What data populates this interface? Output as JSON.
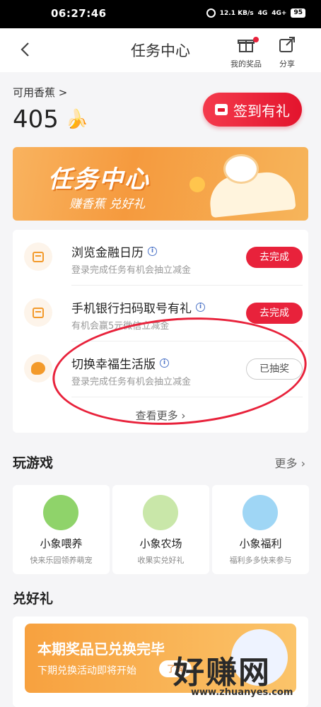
{
  "status": {
    "time": "06:27:46",
    "speed": "12.1 KB/s",
    "net1": "4G",
    "net2": "4G+",
    "battery": "95"
  },
  "header": {
    "title": "任务中心",
    "prizes_label": "我的奖品",
    "share_label": "分享"
  },
  "balance": {
    "label": "可用香蕉",
    "chevron": ">",
    "count": "405",
    "banana_emoji": "🍌"
  },
  "checkin_label": "签到有礼",
  "banner": {
    "headline": "任务中心",
    "subline": "赚香蕉 兑好礼"
  },
  "tasks": [
    {
      "title": "浏览金融日历",
      "desc": "登录完成任务有机会抽立减金",
      "action": "去完成",
      "icon": "calendar-icon"
    },
    {
      "title": "手机银行扫码取号有礼",
      "desc": "有机会赢5元微信立减金",
      "action": "去完成",
      "icon": "calendar-icon"
    },
    {
      "title": "切换幸福生活版",
      "desc": "登录完成任务有机会抽立减金",
      "action": "已抽奖",
      "icon": "palette-icon"
    }
  ],
  "see_more": "查看更多",
  "games_section": {
    "title": "玩游戏",
    "more": "更多"
  },
  "games": [
    {
      "name": "小象喂养",
      "desc": "快来乐园领养萌宠",
      "color": "#8fd36a"
    },
    {
      "name": "小象农场",
      "desc": "收果实兑好礼",
      "color": "#c9e7a9"
    },
    {
      "name": "小象福利",
      "desc": "福利多多快来参与",
      "color": "#9fd6f5"
    }
  ],
  "gifts_section": {
    "title": "兑好礼"
  },
  "gift_card": {
    "headline": "本期奖品已兑换完毕",
    "sub": "下期兑换活动即将开始",
    "chip": "了解"
  },
  "watermark": {
    "text": "好赚网",
    "url": "www.zhuanyes.com"
  }
}
